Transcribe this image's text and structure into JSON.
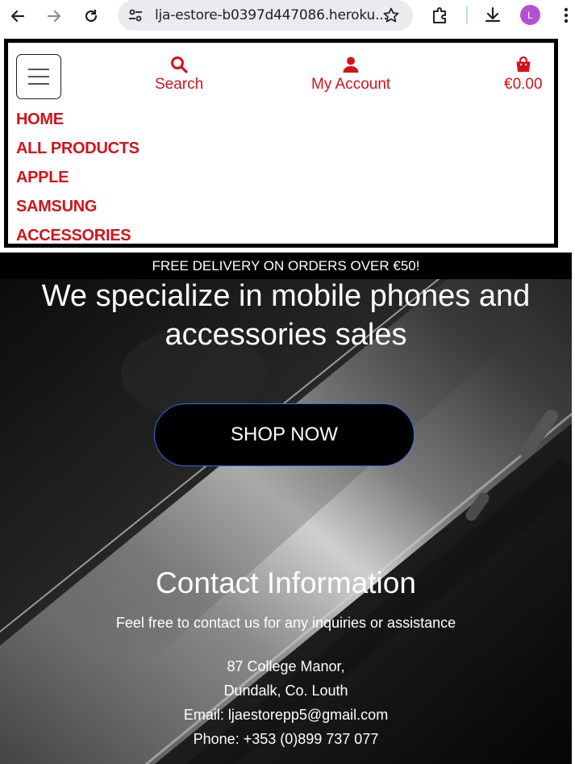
{
  "browser": {
    "url": "lja-estore-b0397d447086.heroku...",
    "profile_initial": "L",
    "icons": [
      "back-arrow-icon",
      "forward-arrow-icon",
      "reload-icon",
      "site-settings-icon",
      "star-icon",
      "extensions-icon",
      "download-icon",
      "more-options-icon"
    ]
  },
  "header": {
    "search_label": "Search",
    "account_label": "My Account",
    "bag_total": "€0.00",
    "nav_items": [
      "HOME",
      "ALL PRODUCTS",
      "APPLE",
      "SAMSUNG",
      "ACCESSORIES"
    ]
  },
  "hero": {
    "banner": "FREE DELIVERY ON ORDERS OVER €50!",
    "headline_line1": "We specialize in mobile phones and",
    "headline_line2": "accessories sales",
    "cta": "SHOP NOW"
  },
  "contact": {
    "title": "Contact Information",
    "subtitle": "Feel free to contact us for any inquiries or assistance",
    "address_line1": "87 College Manor,",
    "address_line2": "Dundalk, Co. Louth",
    "email": "Email: ljaestorepp5@gmail.com",
    "phone": "Phone: +353 (0)899 737 077"
  },
  "colors": {
    "brand_red": "#d1141b",
    "button_border": "#2f6fe0",
    "avatar": "#b54fd6"
  }
}
